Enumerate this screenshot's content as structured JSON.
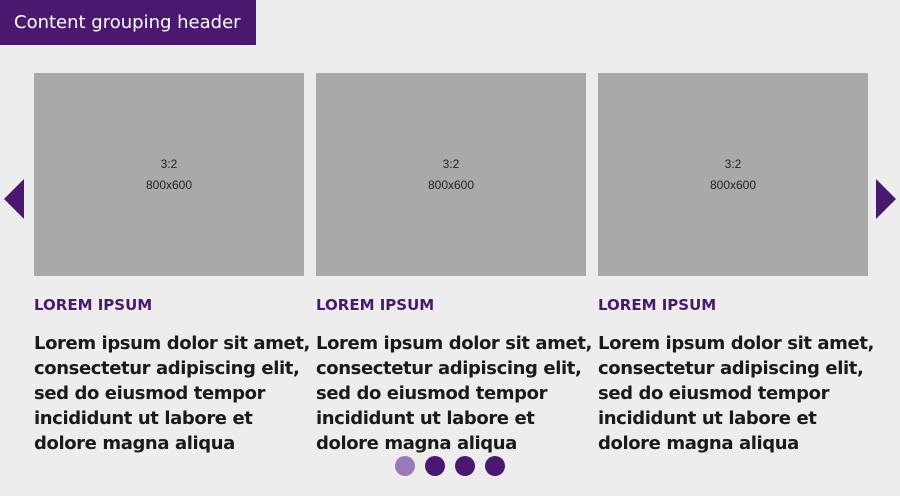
{
  "header": {
    "title": "Content grouping header"
  },
  "colors": {
    "brand": "#4b1870",
    "dot_active": "#9a79b8",
    "placeholder": "#a9a9a9",
    "background": "#eeeded"
  },
  "carousel": {
    "prev_icon": "chevron-left-icon",
    "next_icon": "chevron-right-icon",
    "cards": [
      {
        "image_ratio": "3:2",
        "image_size": "800x600",
        "kicker": "LOREM IPSUM",
        "lines": [
          "Lorem ipsum dolor sit amet,",
          "consectetur adipiscing elit,",
          "sed do eiusmod tempor",
          "incididunt ut labore et",
          "dolore magna aliqua"
        ]
      },
      {
        "image_ratio": "3:2",
        "image_size": "800x600",
        "kicker": "LOREM IPSUM",
        "lines": [
          "Lorem ipsum dolor sit amet,",
          "consectetur adipiscing elit,",
          "sed do eiusmod tempor",
          "incididunt ut labore et",
          "dolore magna aliqua"
        ]
      },
      {
        "image_ratio": "3:2",
        "image_size": "800x600",
        "kicker": "LOREM IPSUM",
        "lines": [
          "Lorem ipsum dolor sit amet,",
          "consectetur adipiscing elit,",
          "sed do eiusmod tempor",
          "incididunt ut labore et",
          "dolore magna aliqua"
        ]
      }
    ],
    "pagination": {
      "count": 4,
      "active_index": 0
    }
  }
}
